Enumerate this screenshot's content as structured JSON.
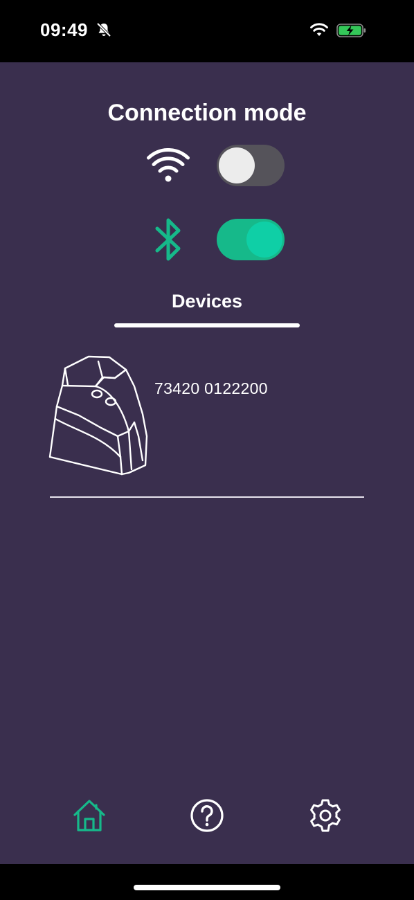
{
  "status_bar": {
    "time": "09:49",
    "icons": [
      "silent-mode-icon",
      "wifi-icon",
      "battery-charging-icon"
    ]
  },
  "screen": {
    "title": "Connection mode",
    "connection": {
      "wifi": {
        "icon": "wifi-icon",
        "enabled": false
      },
      "bluetooth": {
        "icon": "bluetooth-icon",
        "enabled": true
      }
    },
    "tab_label": "Devices",
    "devices": [
      {
        "serial": "73420 0122200",
        "image": "device-icon"
      }
    ]
  },
  "nav": {
    "items": [
      {
        "icon": "home-icon",
        "active": true
      },
      {
        "icon": "help-icon",
        "active": false
      },
      {
        "icon": "settings-icon",
        "active": false
      }
    ]
  },
  "colors": {
    "background": "#3a2f4e",
    "accent": "#16b98a",
    "toggle_off": "#55535a",
    "text": "#ffffff"
  }
}
